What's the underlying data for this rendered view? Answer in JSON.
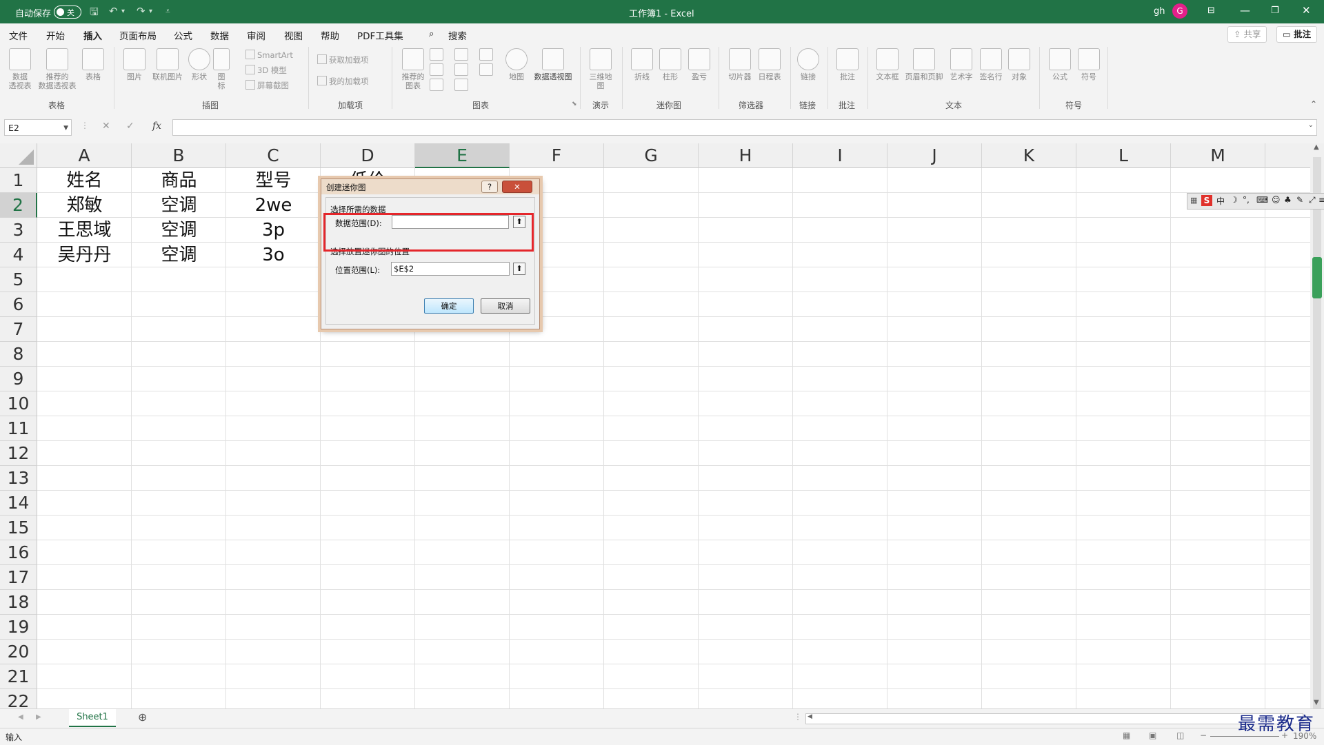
{
  "titlebar": {
    "autosave_label": "自动保存",
    "autosave_state": "关",
    "doc_title": "工作簿1  -  Excel",
    "user_name": "gh",
    "avatar_letter": "G"
  },
  "tabs": [
    "文件",
    "开始",
    "插入",
    "页面布局",
    "公式",
    "数据",
    "审阅",
    "视图",
    "帮助",
    "PDF工具集"
  ],
  "active_tab": "插入",
  "search_label": "搜索",
  "share_label": "共享",
  "comments_label": "批注",
  "ribbon": {
    "table_group": {
      "label": "表格",
      "pivot": "数据\n透视表",
      "rec_pivot": "推荐的\n数据透视表",
      "table": "表格"
    },
    "illus_group": {
      "label": "插图",
      "picture": "图片",
      "online_picture": "联机图片",
      "shapes": "形状",
      "icons": "图\n标",
      "smartart": "SmartArt",
      "model3d": "3D 模型",
      "screenshot": "屏幕截图"
    },
    "addins_group": {
      "label": "加载项",
      "get": "获取加载项",
      "my": "我的加载项"
    },
    "charts_group": {
      "label": "图表",
      "recommended": "推荐的\n图表",
      "maps": "地图",
      "pivotchart": "数据透视图"
    },
    "tours_group": {
      "label": "演示",
      "map3d": "三维地\n图"
    },
    "sparklines_group": {
      "label": "迷你图",
      "line": "折线",
      "column": "柱形",
      "winloss": "盈亏"
    },
    "filters_group": {
      "label": "筛选器",
      "slicer": "切片器",
      "timeline": "日程表"
    },
    "links_group": {
      "label": "链接",
      "link": "链接"
    },
    "comments_group": {
      "label": "批注",
      "comment": "批注"
    },
    "text_group": {
      "label": "文本",
      "textbox": "文本框",
      "headerfooter": "页眉和页脚",
      "wordart": "艺术字",
      "signature": "签名行",
      "object": "对象"
    },
    "symbols_group": {
      "label": "符号",
      "equation": "公式",
      "symbol": "符号"
    }
  },
  "formula_bar": {
    "name_box": "E2",
    "fx": "fx",
    "formula": ""
  },
  "columns": [
    "A",
    "B",
    "C",
    "D",
    "E",
    "F",
    "G",
    "H",
    "I",
    "J",
    "K",
    "L",
    "M",
    "I"
  ],
  "selected_column": "E",
  "selected_row": "2",
  "rows": [
    "1",
    "2",
    "3",
    "4",
    "5",
    "6",
    "7",
    "8",
    "9",
    "10",
    "11",
    "12",
    "13",
    "14",
    "15",
    "16",
    "17",
    "18",
    "19",
    "20",
    "21",
    "22"
  ],
  "cells": [
    [
      "姓名",
      "商品",
      "型号",
      "低价"
    ],
    [
      "郑敏",
      "空调",
      "2we",
      ""
    ],
    [
      "王思域",
      "空调",
      "3p",
      ""
    ],
    [
      "吴丹丹",
      "空调",
      "3o",
      ""
    ]
  ],
  "dialog": {
    "title": "创建迷你图",
    "help": "?",
    "close": "✕",
    "section1": "选择所需的数据",
    "data_range_label": "数据范围(D):",
    "data_range_value": "",
    "section2": "选择放置迷你图的位置",
    "location_label": "位置范围(L):",
    "location_value": "$E$2",
    "ok": "确定",
    "cancel": "取消"
  },
  "sheets": [
    "Sheet1"
  ],
  "status": {
    "mode": "输入",
    "zoom": "190%"
  },
  "watermark": "最需教育",
  "ime": {
    "logo": "S",
    "lang": "中"
  }
}
